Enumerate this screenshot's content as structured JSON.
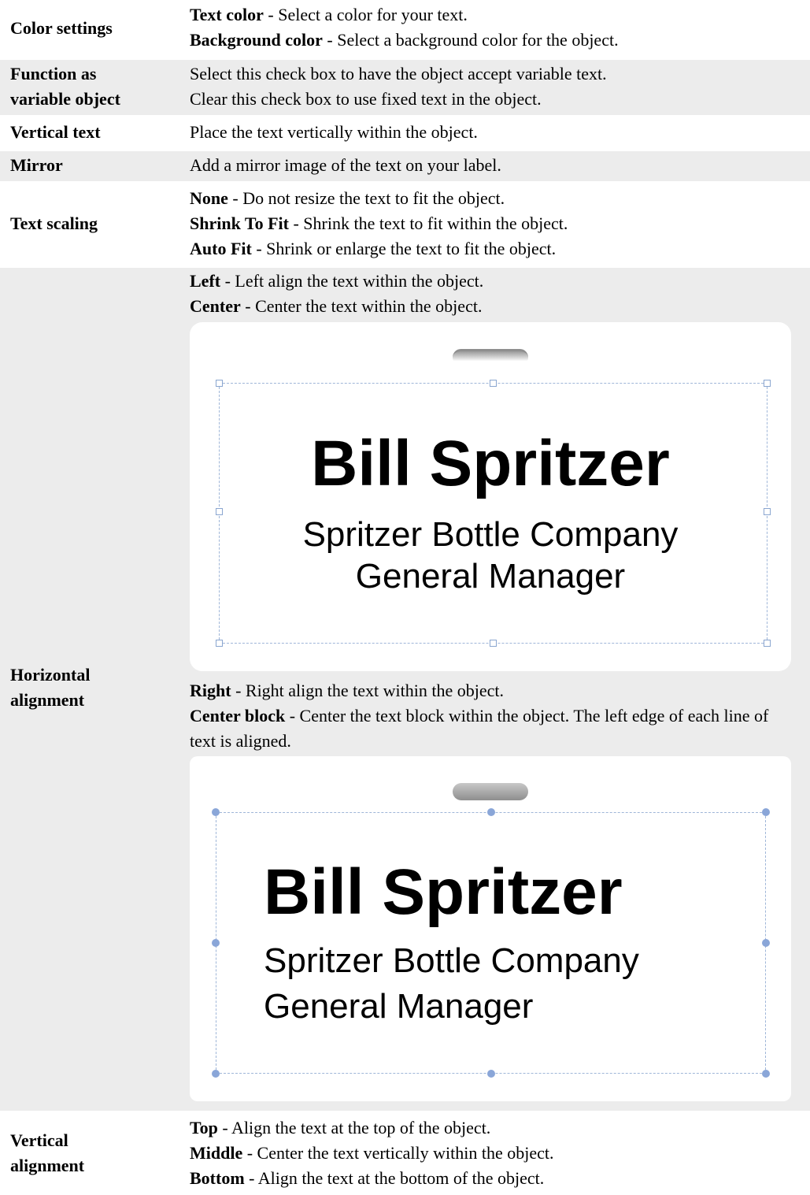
{
  "rows": {
    "color": {
      "term": "Color settings",
      "lines": [
        {
          "bold": "Text color",
          "text": " - Select a color for your text."
        },
        {
          "bold": "Background color",
          "text": " - Select a background color for the object."
        }
      ]
    },
    "variable": {
      "term_lines": [
        "Function as",
        "variable object"
      ],
      "lines": [
        "Select this check box to have the object accept variable text.",
        "Clear this check box to use fixed text in the object."
      ]
    },
    "vertical_text": {
      "term": "Vertical text",
      "text": "Place the text vertically within the object."
    },
    "mirror": {
      "term": "Mirror",
      "text": "Add a mirror image of the text on your label."
    },
    "scaling": {
      "term": "Text scaling",
      "lines": [
        {
          "bold": "None",
          "text": " - Do not resize the text to fit the object."
        },
        {
          "bold": "Shrink To Fit",
          "text": " - Shrink the text to fit within the object."
        },
        {
          "bold": "Auto Fit",
          "text": " - Shrink or enlarge the text to fit the object."
        }
      ]
    },
    "horizontal": {
      "term_lines": [
        "Horizontal",
        "alignment"
      ],
      "lines_top": [
        {
          "bold": "Left",
          "text": " - Left align the text within the object."
        },
        {
          "bold": "Center",
          "text": " - Center the text within the object."
        }
      ],
      "lines_mid": [
        {
          "bold": "Right",
          "text": " - Right align the text within the object."
        },
        {
          "bold": "Center block",
          "text": " - Center the text block within the object. The left edge of each line of text is aligned."
        }
      ]
    },
    "vertical_align": {
      "term_lines": [
        "Vertical",
        "alignment"
      ],
      "lines": [
        {
          "bold": "Top",
          "text": " - Align the text at the top of the object."
        },
        {
          "bold": "Middle",
          "text": " - Center the text vertically within the object."
        },
        {
          "bold": "Bottom",
          "text": " - Align the text at the bottom of the object."
        }
      ]
    }
  },
  "badge": {
    "name": "Bill Spritzer",
    "company": "Spritzer Bottle Company",
    "title": "General Manager"
  }
}
